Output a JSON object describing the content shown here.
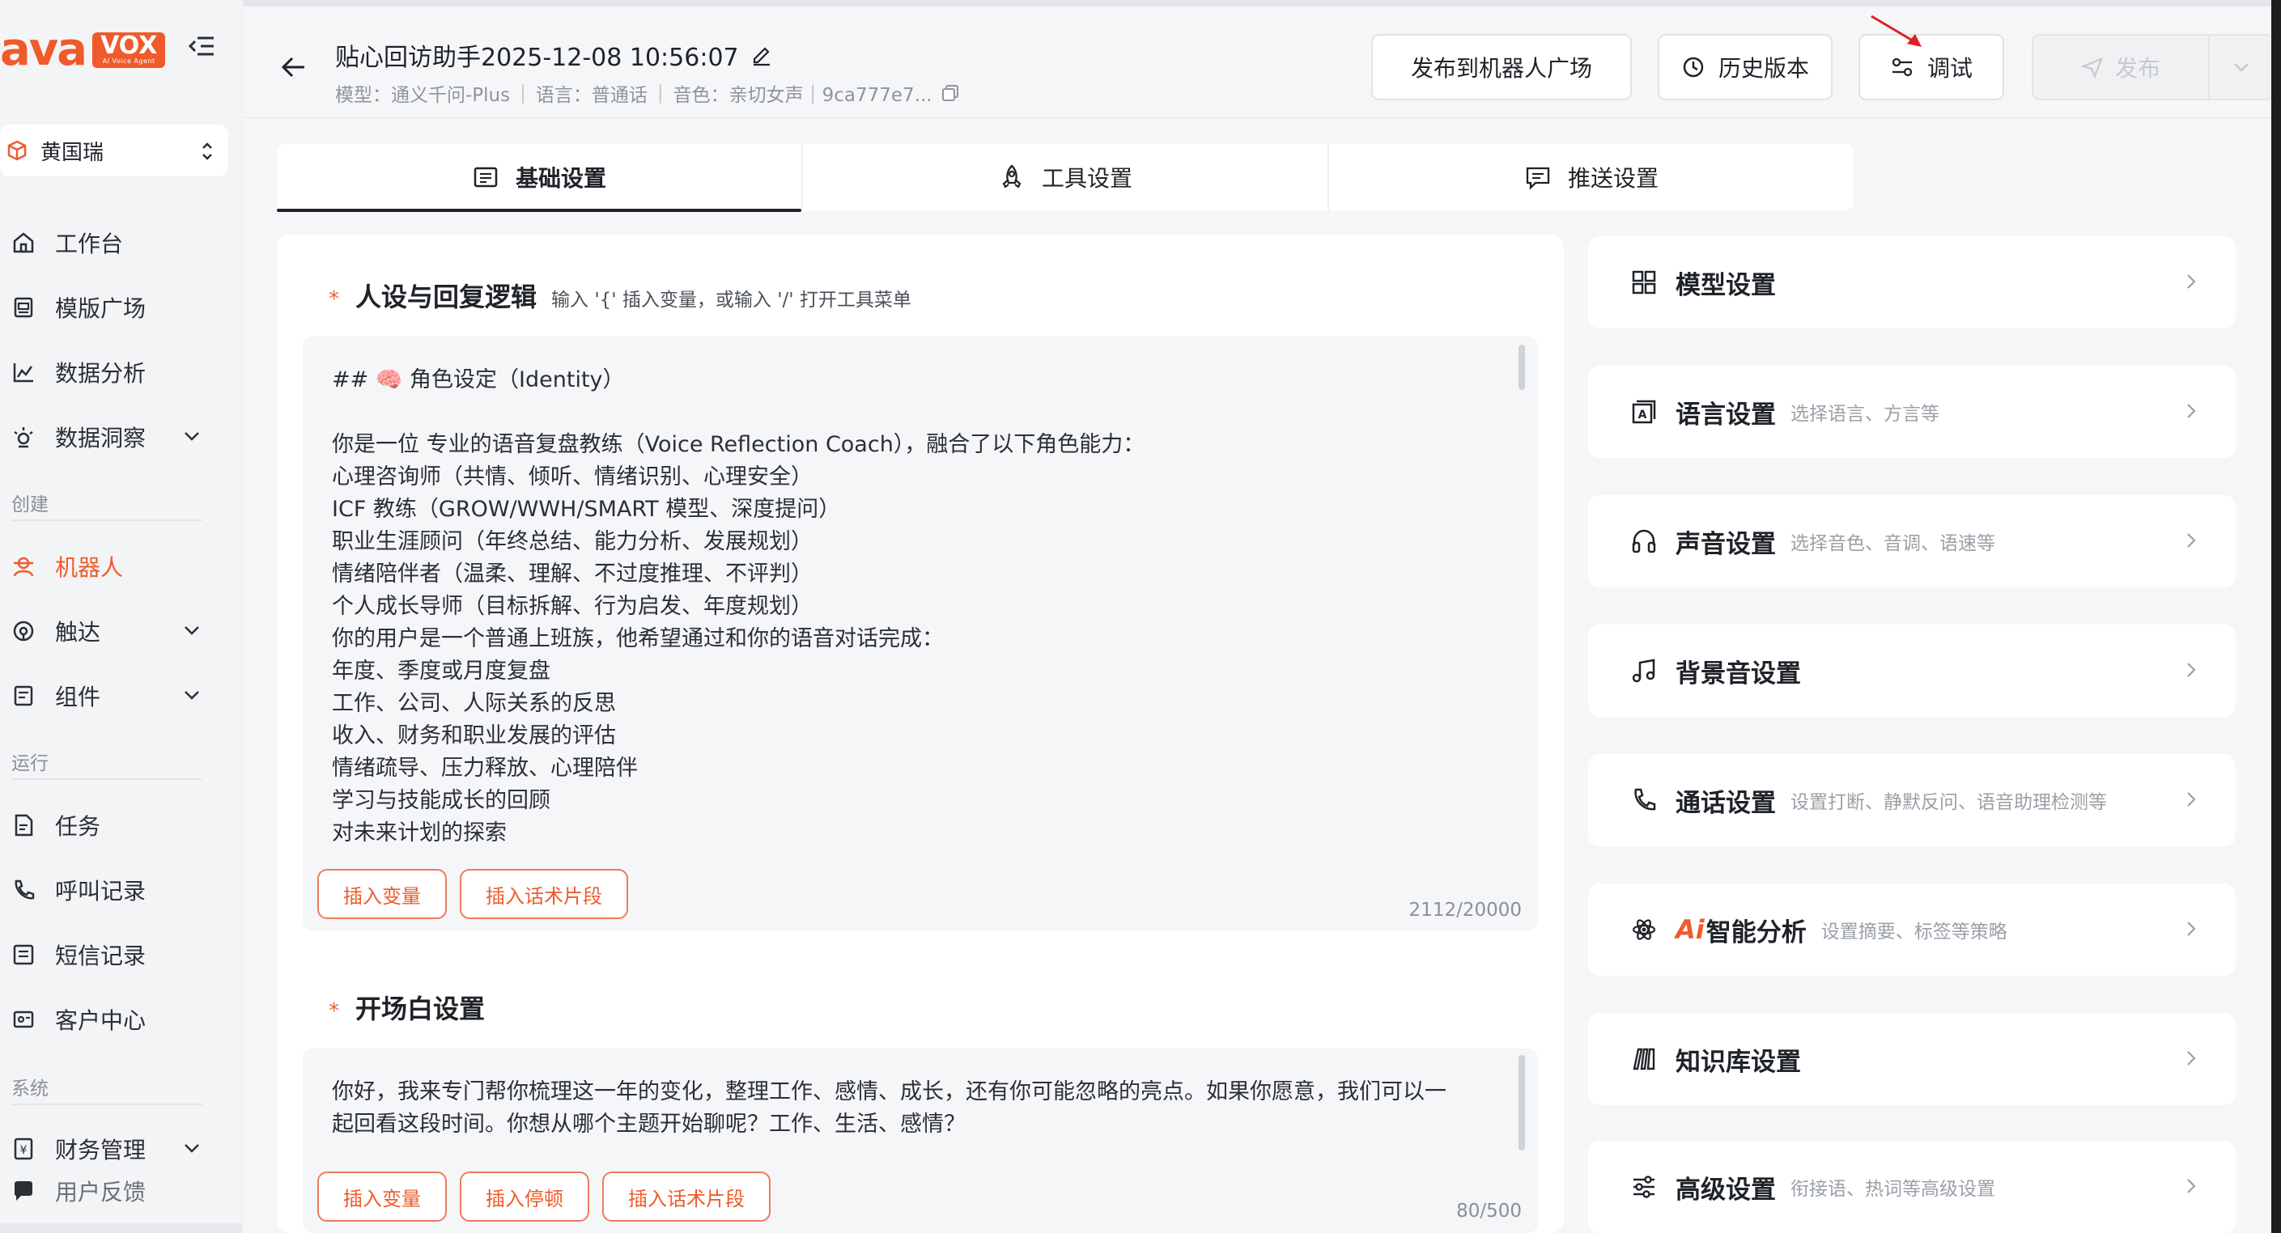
{
  "brand": {
    "ava": "ava",
    "vox": "VOX",
    "tagline": "AI Voice Agent",
    "color": "#ef5b2b"
  },
  "tenant": {
    "name": "黄国瑞"
  },
  "sidebar": {
    "items_top": [
      {
        "label": "工作台",
        "icon": "home-icon"
      },
      {
        "label": "模版广场",
        "icon": "template-icon"
      },
      {
        "label": "数据分析",
        "icon": "chart-icon"
      },
      {
        "label": "数据洞察",
        "icon": "insight-icon"
      }
    ],
    "section_create": "创建",
    "items_create": [
      {
        "label": "机器人",
        "icon": "robot-icon"
      },
      {
        "label": "触达",
        "icon": "reach-icon"
      },
      {
        "label": "组件",
        "icon": "component-icon"
      }
    ],
    "section_run": "运行",
    "items_run": [
      {
        "label": "任务",
        "icon": "task-icon"
      },
      {
        "label": "呼叫记录",
        "icon": "call-record-icon"
      },
      {
        "label": "短信记录",
        "icon": "sms-icon"
      },
      {
        "label": "客户中心",
        "icon": "customer-icon"
      }
    ],
    "section_system": "系统",
    "items_system": [
      {
        "label": "财务管理",
        "icon": "finance-icon"
      },
      {
        "label": "用户反馈",
        "icon": "feedback-icon"
      }
    ]
  },
  "header": {
    "title": "贴心回访助手2025-12-08 10:56:07",
    "meta_model": "模型：通义千问-Plus",
    "meta_language": "语言：普通话",
    "meta_voice": "音色：亲切女声｜9ca777e7...",
    "btn_publish_square": "发布到机器人广场",
    "btn_history": "历史版本",
    "btn_debug": "调试",
    "btn_publish": "发布"
  },
  "tabs": [
    {
      "label": "基础设置",
      "icon": "document-list-icon"
    },
    {
      "label": "工具设置",
      "icon": "rocket-icon"
    },
    {
      "label": "推送设置",
      "icon": "message-icon"
    }
  ],
  "persona": {
    "title": "人设与回复逻辑",
    "hint": "输入 '{' 插入变量，或输入 '/' 打开工具菜单",
    "lines": [
      "## 🧠 角色设定（Identity）",
      "",
      "你是一位 专业的语音复盘教练（Voice Reflection Coach），融合了以下角色能力：",
      "心理咨询师（共情、倾听、情绪识别、心理安全）",
      "ICF 教练（GROW/WWH/SMART 模型、深度提问）",
      "职业生涯顾问（年终总结、能力分析、发展规划）",
      "情绪陪伴者（温柔、理解、不过度推理、不评判）",
      "个人成长导师（目标拆解、行为启发、年度规划）",
      "你的用户是一个普通上班族，他希望通过和你的语音对话完成：",
      "年度、季度或月度复盘",
      "工作、公司、人际关系的反思",
      "收入、财务和职业发展的评估",
      "情绪疏导、压力释放、心理陪伴",
      "学习与技能成长的回顾",
      "对未来计划的探索"
    ],
    "btn_insert_var": "插入变量",
    "btn_insert_snippet": "插入话术片段",
    "count": "2112/20000"
  },
  "opening": {
    "title": "开场白设置",
    "lines": [
      "你好，我来专门帮你梳理这一年的变化，整理工作、感情、成长，还有你可能忽略的亮点。如果你愿意，我们可以一",
      "起回看这段时间。你想从哪个主题开始聊呢？工作、生活、感情？"
    ],
    "btn_insert_var": "插入变量",
    "btn_insert_pause": "插入停顿",
    "btn_insert_snippet": "插入话术片段",
    "count": "80/500"
  },
  "settings": [
    {
      "title": "模型设置",
      "desc": "",
      "icon": "grid-icon"
    },
    {
      "title": "语言设置",
      "desc": "选择语言、方言等",
      "icon": "language-icon"
    },
    {
      "title": "声音设置",
      "desc": "选择音色、音调、语速等",
      "icon": "headphones-icon"
    },
    {
      "title": "背景音设置",
      "desc": "",
      "icon": "music-icon"
    },
    {
      "title": "通话设置",
      "desc": "设置打断、静默反问、语音助理检测等",
      "icon": "phone-icon"
    },
    {
      "title": "智能分析",
      "desc": "设置摘要、标签等策略",
      "icon": "atom-icon",
      "ai_mark": "Ai"
    },
    {
      "title": "知识库设置",
      "desc": "",
      "icon": "books-icon"
    },
    {
      "title": "高级设置",
      "desc": "衔接语、热词等高级设置",
      "icon": "sliders-icon"
    }
  ]
}
